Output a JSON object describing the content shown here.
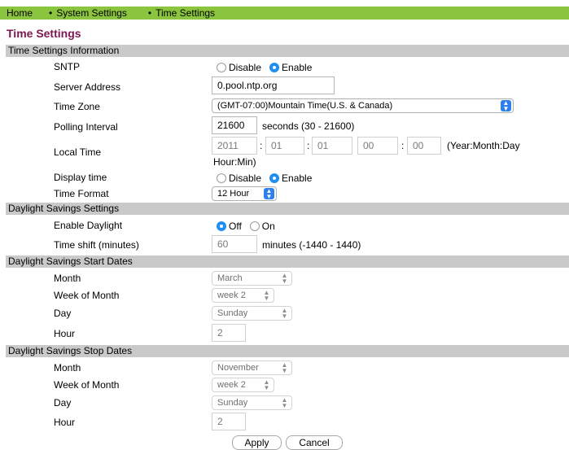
{
  "nav": {
    "home": "Home",
    "system_settings": "System Settings",
    "time_settings": "Time Settings",
    "bullet": "•"
  },
  "page_title": "Time Settings",
  "sections": {
    "info": "Time Settings Information",
    "daylight": "Daylight Savings Settings",
    "start": "Daylight Savings Start Dates",
    "stop": "Daylight Savings Stop Dates"
  },
  "sntp": {
    "label": "SNTP",
    "disable": "Disable",
    "enable": "Enable",
    "selected": "Enable"
  },
  "server": {
    "label": "Server Address",
    "value": "0.pool.ntp.org"
  },
  "timezone": {
    "label": "Time Zone",
    "value": "(GMT-07:00)Mountain Time(U.S. & Canada)"
  },
  "polling": {
    "label": "Polling Interval",
    "value": "21600",
    "hint": "seconds (30 - 21600)"
  },
  "localtime": {
    "label": "Local Time",
    "year": "2011",
    "month": "01",
    "day": "01",
    "hour": "00",
    "minute": "00",
    "sep": ":",
    "hint1": "(Year:Month:Day",
    "hint2": "Hour:Min)"
  },
  "display_time": {
    "label": "Display time",
    "disable": "Disable",
    "enable": "Enable",
    "selected": "Enable"
  },
  "time_format": {
    "label": "Time Format",
    "value": "12 Hour"
  },
  "enable_daylight": {
    "label": "Enable Daylight",
    "off": "Off",
    "on": "On",
    "selected": "Off"
  },
  "time_shift": {
    "label": "Time shift (minutes)",
    "value": "60",
    "hint": "minutes (-1440 - 1440)"
  },
  "start": {
    "month_label": "Month",
    "month": "March",
    "week_label": "Week of Month",
    "week": "week 2",
    "day_label": "Day",
    "day": "Sunday",
    "hour_label": "Hour",
    "hour": "2"
  },
  "stop": {
    "month_label": "Month",
    "month": "November",
    "week_label": "Week of Month",
    "week": "week 2",
    "day_label": "Day",
    "day": "Sunday",
    "hour_label": "Hour",
    "hour": "2"
  },
  "buttons": {
    "apply": "Apply",
    "cancel": "Cancel"
  },
  "colors": {
    "nav_bg": "#8bc53f",
    "title": "#7b1650",
    "section_bg": "#c9c9c9",
    "radio_selected": "#1f8ff2"
  }
}
